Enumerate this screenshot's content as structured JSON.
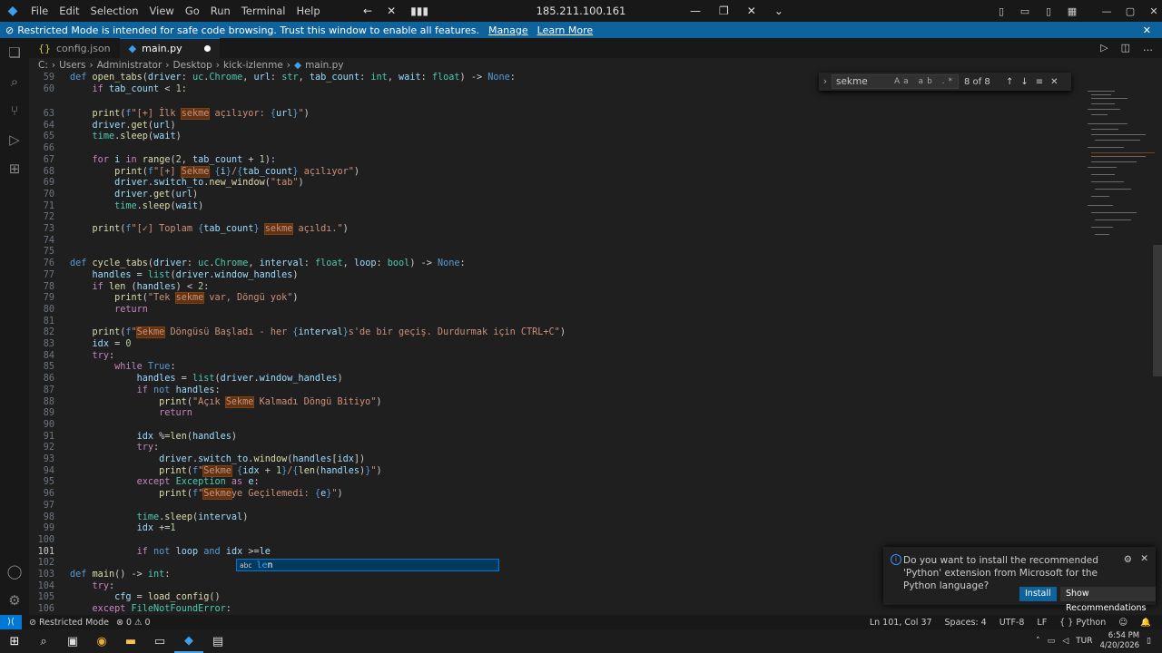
{
  "titlebar": {
    "menu": [
      "File",
      "Edit",
      "Selection",
      "View",
      "Go",
      "Run",
      "Terminal",
      "Help"
    ],
    "remote_host": "185.211.100.161"
  },
  "banner": {
    "message": "Restricted Mode is intended for safe code browsing. Trust this window to enable all features.",
    "manage": "Manage",
    "learn_more": "Learn More"
  },
  "tabs": [
    {
      "label": "config.json",
      "icon": "{}"
    },
    {
      "label": "main.py",
      "icon": "python"
    }
  ],
  "breadcrumb": [
    "C:",
    "Users",
    "Administrator",
    "Desktop",
    "kick-izlenme",
    "main.py"
  ],
  "find": {
    "query": "sekme",
    "options": "Aa ab .*",
    "count": "8 of 8"
  },
  "code_lines": [
    {
      "n": "59"
    },
    {
      "n": "60"
    },
    {
      "n": "63"
    },
    {
      "n": "64"
    },
    {
      "n": "65"
    },
    {
      "n": "66"
    },
    {
      "n": "67"
    },
    {
      "n": "68"
    },
    {
      "n": "69"
    },
    {
      "n": "70"
    },
    {
      "n": "71"
    },
    {
      "n": "72"
    },
    {
      "n": "73"
    },
    {
      "n": "74"
    },
    {
      "n": "75"
    },
    {
      "n": "76"
    },
    {
      "n": "77"
    },
    {
      "n": "78"
    },
    {
      "n": "79"
    },
    {
      "n": "80"
    },
    {
      "n": "81"
    },
    {
      "n": "82"
    },
    {
      "n": "83"
    },
    {
      "n": "84"
    },
    {
      "n": "85"
    },
    {
      "n": "86"
    },
    {
      "n": "87"
    },
    {
      "n": "88"
    },
    {
      "n": "89"
    },
    {
      "n": "90"
    },
    {
      "n": "91"
    },
    {
      "n": "92"
    },
    {
      "n": "93"
    },
    {
      "n": "94"
    },
    {
      "n": "95"
    },
    {
      "n": "96"
    },
    {
      "n": "97"
    },
    {
      "n": "98"
    },
    {
      "n": "99"
    },
    {
      "n": "100"
    },
    {
      "n": "101"
    },
    {
      "n": "102"
    },
    {
      "n": "103"
    },
    {
      "n": "104"
    },
    {
      "n": "105"
    },
    {
      "n": "106"
    }
  ],
  "suggest": {
    "kind": "abc",
    "match": "le",
    "rest": "n"
  },
  "notification": {
    "message": "Do you want to install the recommended 'Python' extension from Microsoft for the Python language?",
    "install": "Install",
    "recommendations": "Show Recommendations"
  },
  "statusbar": {
    "mode": "Restricted Mode",
    "problems": "0",
    "warnings": "0",
    "position": "Ln 101, Col 37",
    "spaces": "Spaces: 4",
    "encoding": "UTF-8",
    "eol": "LF",
    "language": "Python"
  },
  "taskbar": {
    "lang": "TUR",
    "time": "6:54 PM",
    "date": "4/20/2026"
  }
}
